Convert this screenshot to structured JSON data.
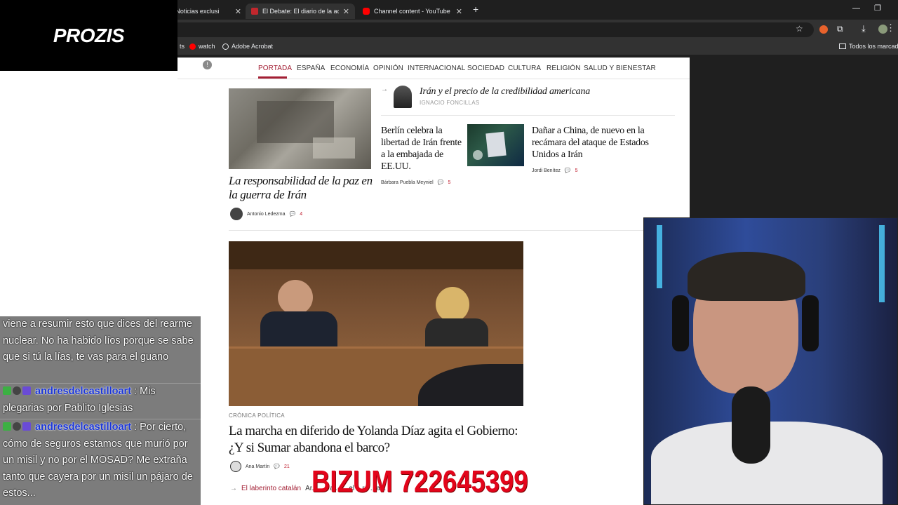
{
  "browser": {
    "tabs": [
      {
        "title": "e | Noticias exclusi",
        "active": false
      },
      {
        "title": "El Debate: El diario de la actual",
        "active": true
      },
      {
        "title": "Channel content - YouTube Stu",
        "active": false
      }
    ],
    "new_tab_symbol": "+",
    "bookmarks": {
      "left": "ts",
      "watch": "watch",
      "acrobat": "Adobe Acrobat",
      "all": "Todos los marcadores"
    }
  },
  "site": {
    "nav": [
      "PORTADA",
      "ESPAÑA",
      "ECONOMÍA",
      "OPINIÓN",
      "INTERNACIONAL",
      "SOCIEDAD",
      "CULTURA",
      "RELIGIÓN",
      "SALUD Y BIENESTAR"
    ],
    "opinion": {
      "title": "Irán y el precio de la credibilidad americana",
      "author": "IGNACIO FONCILLAS"
    },
    "lead_story": {
      "title": "La responsabilidad de la paz en la guerra de Irán",
      "author": "Antonio Ledezma",
      "comments": "4"
    },
    "story2": {
      "title": "Berlín celebra la libertad de Irán frente a la embajada de EE.UU.",
      "author": "Bárbara Puebla Meyniel",
      "comments": "5"
    },
    "story3": {
      "title": "Dañar a China, de nuevo en la recámara del ataque de Estados Unidos a Irán",
      "author": "Jordi Benítez",
      "comments": "5"
    },
    "feature": {
      "kicker": "CRÓNICA POLÍTICA",
      "title": "La marcha en diferido de Yolanda Díaz agita el Gobierno: ¿Y si Sumar abandona el barco?",
      "author": "Ana Martín",
      "comments": "21"
    },
    "related": {
      "arrow": "→",
      "link": "El laberinto catalán",
      "text": "Ar... ...r al... ...el ...re ...a..."
    }
  },
  "overlay": {
    "brand": "PROZIS",
    "bizum": "BIZUM 722645399",
    "chat": [
      {
        "user": "",
        "text": "viene a resumir esto que dices del rearme nuclear. No ha habido líos porque se sabe que si tú la lías, te vas para el guano"
      },
      {
        "user": "andresdelcastilloart",
        "text": ": Mis plegarias por Pablito Iglesias"
      },
      {
        "user": "andresdelcastilloart",
        "text": ": Por cierto, cómo de seguros estamos que murió por un misil y no por el MOSAD? Me extraña tanto que cayera por un misil un pájaro de estos..."
      }
    ]
  },
  "colors": {
    "accent": "#a31f34",
    "comment": "#c01f2f",
    "bizum": "#e3051b",
    "chat_user": "#1a35d8"
  }
}
